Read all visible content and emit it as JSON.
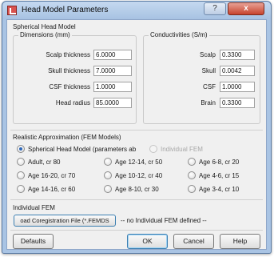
{
  "window": {
    "title": "Head Model Parameters",
    "help_label": "?",
    "close_label": "x"
  },
  "spherical": {
    "title": "Spherical Head Model",
    "dimensions": {
      "title": "Dimensions (mm)",
      "rows": [
        {
          "label": "Scalp thickness",
          "value": "6.0000"
        },
        {
          "label": "Skull thickness",
          "value": "7.0000"
        },
        {
          "label": "CSF thickness",
          "value": "1.0000"
        },
        {
          "label": "Head radius",
          "value": "85.0000"
        }
      ]
    },
    "conductivities": {
      "title": "Conductivities (S/m)",
      "rows": [
        {
          "label": "Scalp",
          "value": "0.3300"
        },
        {
          "label": "Skull",
          "value": "0.0042"
        },
        {
          "label": "CSF",
          "value": "1.0000"
        },
        {
          "label": "Brain",
          "value": "0.3300"
        }
      ]
    }
  },
  "realistic": {
    "title": "Realistic Approximation (FEM Models)",
    "spherical_option": "Spherical Head Model (parameters ab",
    "individual_option": "Individual FEM",
    "options": [
      [
        "Adult, cr 80",
        "Age 12-14, cr 50",
        "Age 6-8, cr 20"
      ],
      [
        "Age 16-20, cr 70",
        "Age 10-12, cr 40",
        "Age 4-6, cr 15"
      ],
      [
        "Age 14-16, cr 60",
        "Age 8-10, cr 30",
        "Age 3-4, cr 10"
      ]
    ]
  },
  "individual": {
    "title": "Individual FEM",
    "load_button": "oad Coregistration File (*.FEMDS",
    "status": "-- no Individual FEM defined --"
  },
  "buttons": {
    "defaults": "Defaults",
    "ok": "OK",
    "cancel": "Cancel",
    "help": "Help"
  }
}
